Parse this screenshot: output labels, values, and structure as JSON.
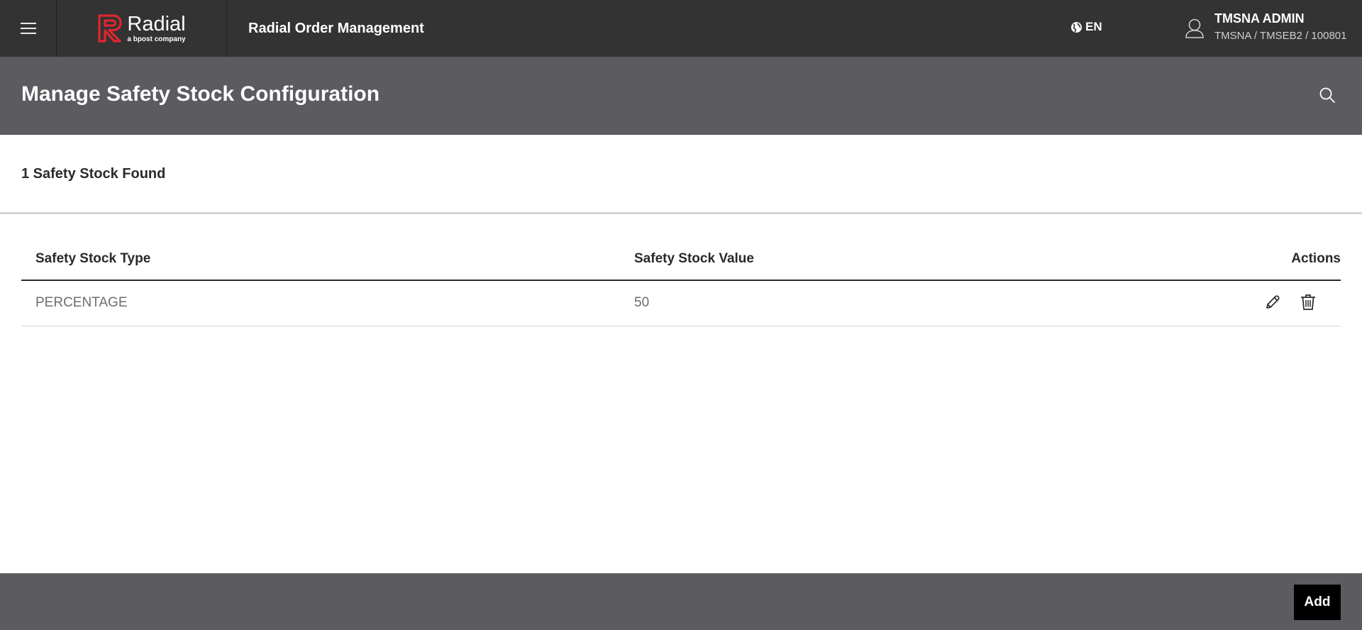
{
  "topbar": {
    "menu_icon": "hamburger-menu-icon",
    "logo": {
      "name": "Radial",
      "tagline": "a bpost company",
      "mark_color": "#e0262e"
    },
    "app_title": "Radial Order Management",
    "language": {
      "icon": "globe-icon",
      "label": "EN"
    },
    "user": {
      "icon": "user-icon",
      "name": "TMSNA ADMIN",
      "org": "TMSNA / TMSEB2 / 100801"
    }
  },
  "page": {
    "title": "Manage Safety Stock Configuration",
    "search_icon": "search-icon"
  },
  "results": {
    "count_text": "1 Safety Stock Found"
  },
  "table": {
    "columns": [
      "Safety Stock Type",
      "Safety Stock Value",
      "Actions"
    ],
    "rows": [
      {
        "type": "PERCENTAGE",
        "value": "50",
        "actions": [
          "edit-icon",
          "trash-icon"
        ]
      }
    ]
  },
  "footer": {
    "add_label": "Add"
  },
  "colors": {
    "topbar_bg": "#333333",
    "header_bg": "#5b5b60",
    "brand_red": "#e0262e",
    "add_button_bg": "#000000"
  }
}
